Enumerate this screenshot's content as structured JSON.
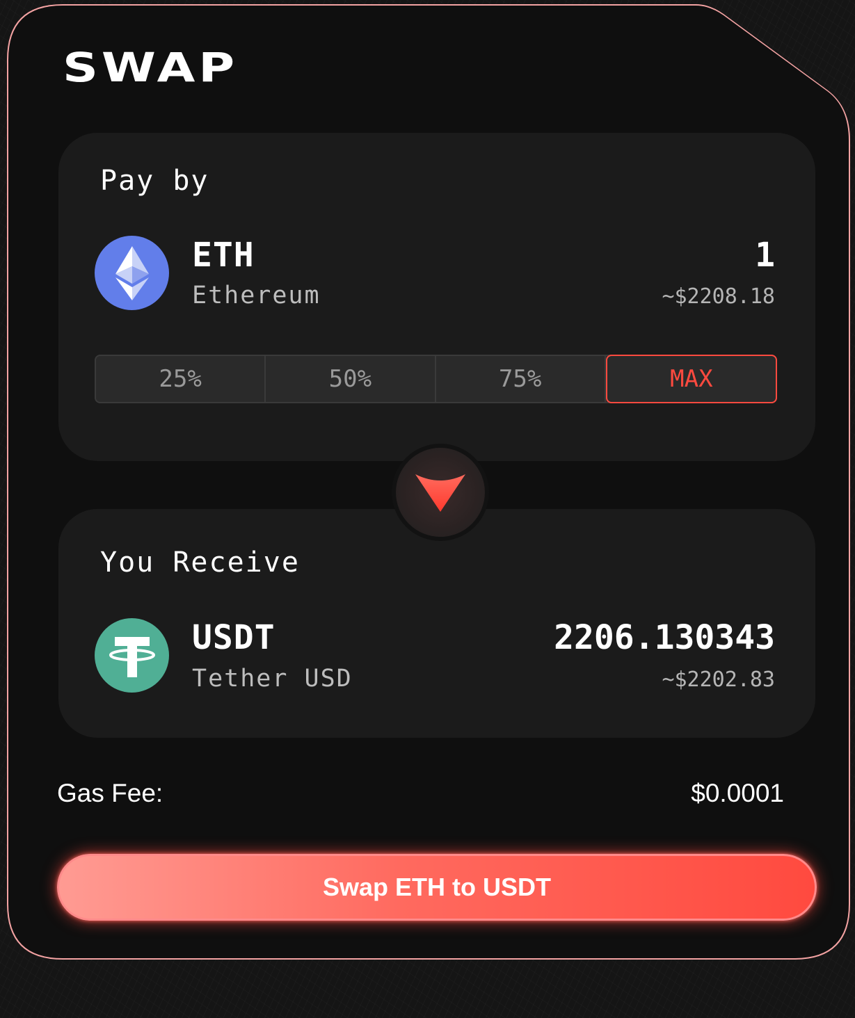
{
  "title": "SWAP",
  "pay": {
    "label": "Pay by",
    "symbol": "ETH",
    "name": "Ethereum",
    "amount": "1",
    "fiat": "~$2208.18",
    "icon": "ethereum-icon",
    "percent_options": [
      "25%",
      "50%",
      "75%",
      "MAX"
    ],
    "selected_option": "MAX"
  },
  "receive": {
    "label": "You Receive",
    "symbol": "USDT",
    "name": "Tether USD",
    "amount": "2206.130343",
    "fiat": "~$2202.83",
    "icon": "tether-icon"
  },
  "gas": {
    "label": "Gas Fee:",
    "value": "$0.0001"
  },
  "action": {
    "label": "Swap ETH to USDT"
  },
  "colors": {
    "accent": "#ff4a3f",
    "eth": "#627eea",
    "usdt": "#50af95",
    "background": "#0f0f0f",
    "panel": "#1b1b1b"
  }
}
